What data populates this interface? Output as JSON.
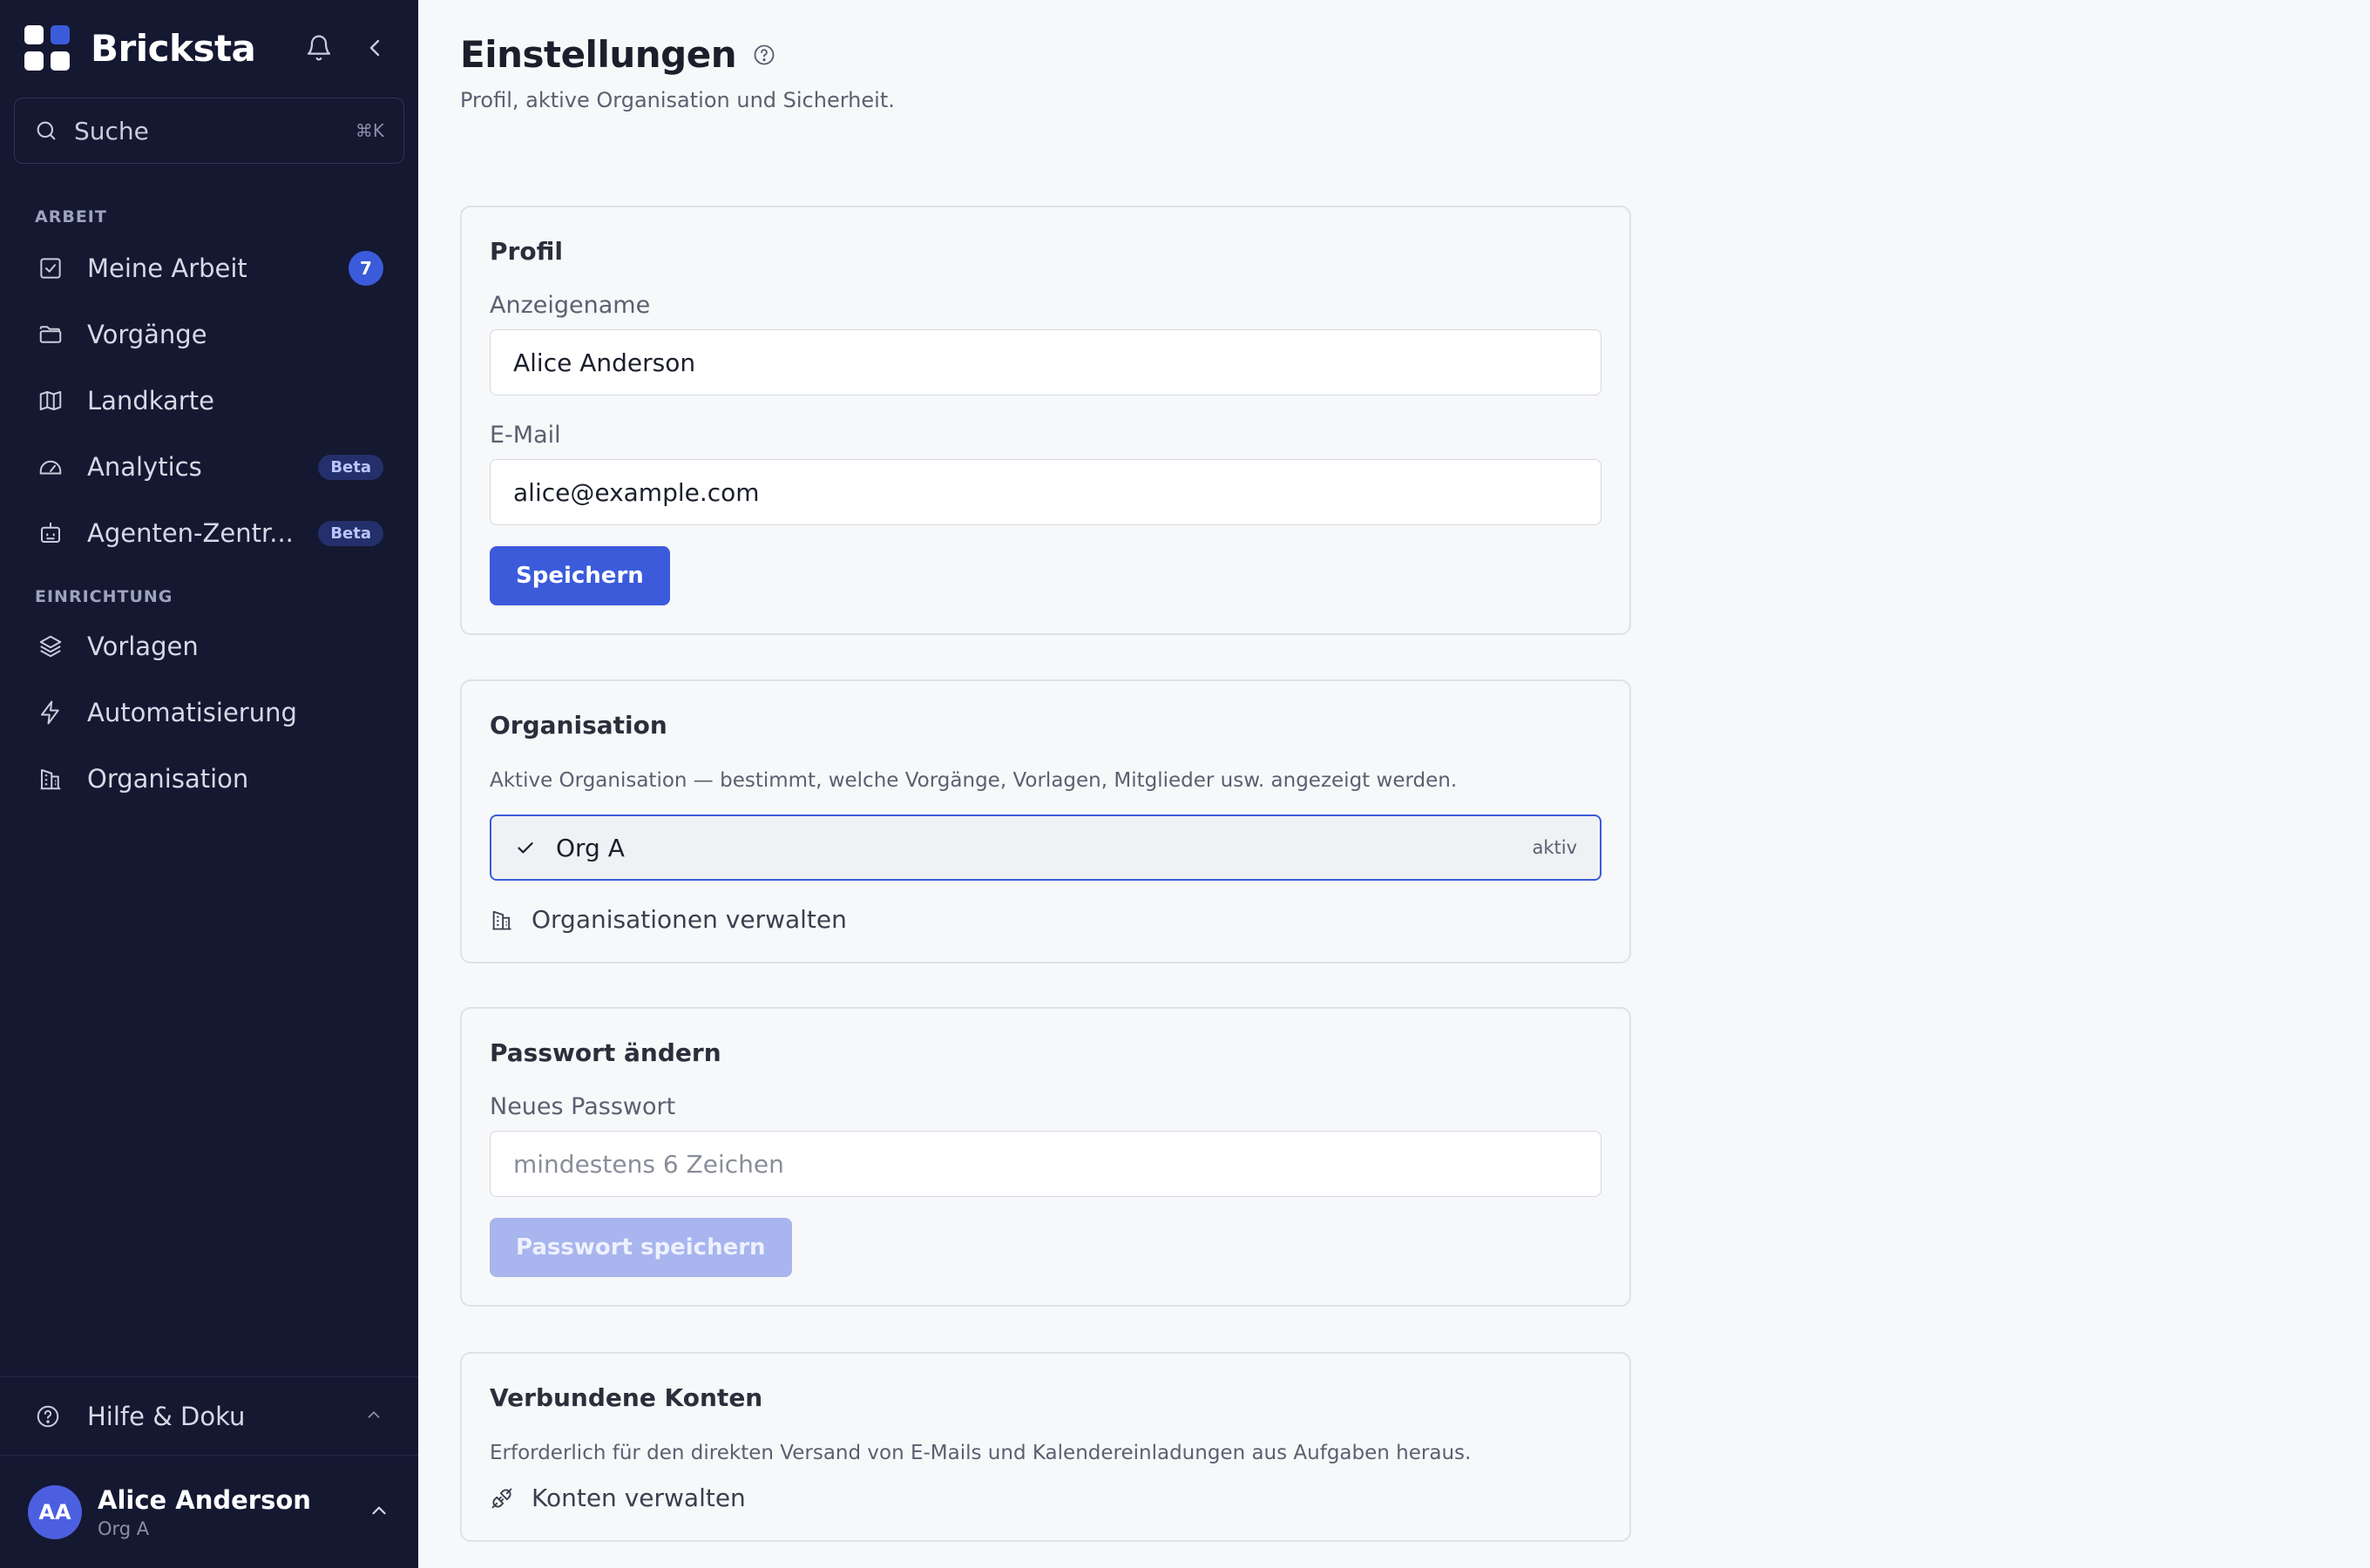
{
  "app": {
    "brand": "Bricksta"
  },
  "sidebar": {
    "search": {
      "label": "Suche",
      "shortcut": "⌘K"
    },
    "sections": {
      "arbeit": "ARBEIT",
      "einrichtung": "EINRICHTUNG"
    },
    "arbeit_items": [
      {
        "label": "Meine Arbeit",
        "badge": "7",
        "icon": "checkbox-icon"
      },
      {
        "label": "Vorgänge",
        "icon": "folder-icon"
      },
      {
        "label": "Landkarte",
        "icon": "map-icon"
      },
      {
        "label": "Analytics",
        "badge": "Beta",
        "icon": "gauge-icon"
      },
      {
        "label": "Agenten-Zentr...",
        "badge": "Beta",
        "icon": "robot-icon"
      }
    ],
    "einrichtung_items": [
      {
        "label": "Vorlagen",
        "icon": "layers-icon"
      },
      {
        "label": "Automatisierung",
        "icon": "bolt-icon"
      },
      {
        "label": "Organisation",
        "icon": "building-icon"
      }
    ],
    "help": {
      "label": "Hilfe & Doku"
    },
    "user": {
      "initials": "AA",
      "name": "Alice Anderson",
      "org": "Org A"
    }
  },
  "page": {
    "title": "Einstellungen",
    "subtitle": "Profil, aktive Organisation und Sicherheit."
  },
  "profile": {
    "title": "Profil",
    "name_label": "Anzeigename",
    "name_value": "Alice Anderson",
    "email_label": "E-Mail",
    "email_value": "alice@example.com",
    "save_label": "Speichern"
  },
  "organisation": {
    "title": "Organisation",
    "description": "Aktive Organisation — bestimmt, welche Vorgänge, Vorlagen, Mitglieder usw. angezeigt werden.",
    "selected_org": "Org A",
    "selected_state": "aktiv",
    "manage_label": "Organisationen verwalten"
  },
  "password": {
    "title": "Passwort ändern",
    "new_label": "Neues Passwort",
    "placeholder": "mindestens 6 Zeichen",
    "save_label": "Passwort speichern"
  },
  "accounts": {
    "title": "Verbundene Konten",
    "description": "Erforderlich für den direkten Versand von E-Mails und Kalendereinladungen aus Aufgaben heraus.",
    "manage_label": "Konten verwalten"
  },
  "colors": {
    "sidebar_bg": "#141831",
    "accent": "#3b5bdb",
    "page_bg": "#f7f8fa"
  }
}
